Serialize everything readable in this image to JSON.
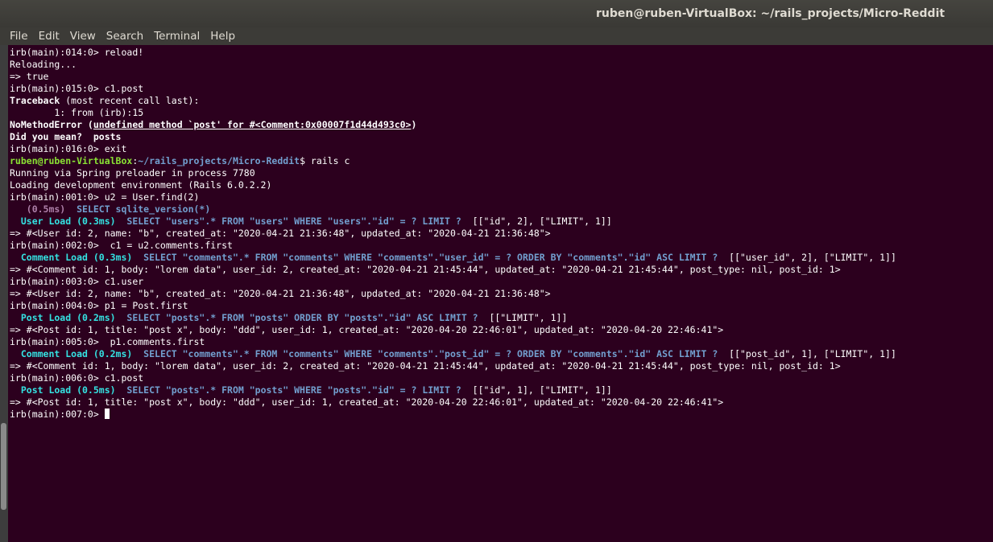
{
  "window": {
    "title": "ruben@ruben-VirtualBox: ~/rails_projects/Micro-Reddit"
  },
  "menu": [
    "File",
    "Edit",
    "View",
    "Search",
    "Terminal",
    "Help"
  ],
  "colors": {
    "background": "#2c001e",
    "prompt_user": "#8ae234",
    "prompt_path": "#729fcf",
    "model_load": "#34e2e2",
    "sql": "#729fcf",
    "timing": "#ad7fa8"
  },
  "terminal": {
    "lines": [
      [
        {
          "t": "irb(main):014:0> reload!",
          "s": "plain"
        }
      ],
      [
        {
          "t": "Reloading...",
          "s": "plain"
        }
      ],
      [
        {
          "t": "=> true",
          "s": "plain"
        }
      ],
      [
        {
          "t": "irb(main):015:0> c1.post",
          "s": "plain"
        }
      ],
      [
        {
          "t": "Traceback",
          "s": "bold"
        },
        {
          "t": " (most recent call last):",
          "s": "plain"
        }
      ],
      [
        {
          "t": "        1: from (irb):15",
          "s": "plain"
        }
      ],
      [
        {
          "t": "NoMethodError (",
          "s": "bold"
        },
        {
          "t": "undefined method `post' for #<Comment:0x00007f1d44d493c0>",
          "s": "boldul"
        },
        {
          "t": ")",
          "s": "bold"
        }
      ],
      [
        {
          "t": "Did you mean?  posts",
          "s": "bold"
        }
      ],
      [
        {
          "t": "irb(main):016:0> exit",
          "s": "plain"
        }
      ],
      [
        {
          "t": "ruben@ruben-VirtualBox",
          "s": "green"
        },
        {
          "t": ":",
          "s": "plain"
        },
        {
          "t": "~/rails_projects/Micro-Reddit",
          "s": "blue"
        },
        {
          "t": "$ rails c",
          "s": "plain"
        }
      ],
      [
        {
          "t": "Running via Spring preloader in process 7780",
          "s": "plain"
        }
      ],
      [
        {
          "t": "Loading development environment (Rails 6.0.2.2)",
          "s": "plain"
        }
      ],
      [
        {
          "t": "irb(main):001:0> u2 = User.find(2)",
          "s": "plain"
        }
      ],
      [
        {
          "t": "   (0.5ms)  ",
          "s": "magenta"
        },
        {
          "t": "SELECT sqlite_version(*)",
          "s": "sqlblue"
        }
      ],
      [
        {
          "t": "  User Load (0.3ms)  ",
          "s": "cyan"
        },
        {
          "t": "SELECT \"users\".* FROM \"users\" WHERE \"users\".\"id\" = ? LIMIT ?",
          "s": "sqlblue"
        },
        {
          "t": "  [[\"id\", 2], [\"LIMIT\", 1]]",
          "s": "plain"
        }
      ],
      [
        {
          "t": "=> #<User id: 2, name: \"b\", created_at: \"2020-04-21 21:36:48\", updated_at: \"2020-04-21 21:36:48\">",
          "s": "plain"
        }
      ],
      [
        {
          "t": "irb(main):002:0>  c1 = u2.comments.first",
          "s": "plain"
        }
      ],
      [
        {
          "t": "  Comment Load (0.3ms)  ",
          "s": "cyan"
        },
        {
          "t": "SELECT \"comments\".* FROM \"comments\" WHERE \"comments\".\"user_id\" = ? ORDER BY \"comments\".\"id\" ASC LIMIT ?",
          "s": "sqlblue"
        },
        {
          "t": "  [[\"user_id\", 2], [\"LIMIT\", 1]]",
          "s": "plain"
        }
      ],
      [
        {
          "t": "=> #<Comment id: 1, body: \"lorem data\", user_id: 2, created_at: \"2020-04-21 21:45:44\", updated_at: \"2020-04-21 21:45:44\", post_type: nil, post_id: 1>",
          "s": "plain"
        }
      ],
      [
        {
          "t": "irb(main):003:0> c1.user",
          "s": "plain"
        }
      ],
      [
        {
          "t": "=> #<User id: 2, name: \"b\", created_at: \"2020-04-21 21:36:48\", updated_at: \"2020-04-21 21:36:48\">",
          "s": "plain"
        }
      ],
      [
        {
          "t": "irb(main):004:0> p1 = Post.first",
          "s": "plain"
        }
      ],
      [
        {
          "t": "  Post Load (0.2ms)  ",
          "s": "cyan"
        },
        {
          "t": "SELECT \"posts\".* FROM \"posts\" ORDER BY \"posts\".\"id\" ASC LIMIT ?",
          "s": "sqlblue"
        },
        {
          "t": "  [[\"LIMIT\", 1]]",
          "s": "plain"
        }
      ],
      [
        {
          "t": "=> #<Post id: 1, title: \"post x\", body: \"ddd\", user_id: 1, created_at: \"2020-04-20 22:46:01\", updated_at: \"2020-04-20 22:46:41\">",
          "s": "plain"
        }
      ],
      [
        {
          "t": "irb(main):005:0>  p1.comments.first",
          "s": "plain"
        }
      ],
      [
        {
          "t": "  Comment Load (0.2ms)  ",
          "s": "cyan"
        },
        {
          "t": "SELECT \"comments\".* FROM \"comments\" WHERE \"comments\".\"post_id\" = ? ORDER BY \"comments\".\"id\" ASC LIMIT ?",
          "s": "sqlblue"
        },
        {
          "t": "  [[\"post_id\", 1], [\"LIMIT\", 1]]",
          "s": "plain"
        }
      ],
      [
        {
          "t": "=> #<Comment id: 1, body: \"lorem data\", user_id: 2, created_at: \"2020-04-21 21:45:44\", updated_at: \"2020-04-21 21:45:44\", post_type: nil, post_id: 1>",
          "s": "plain"
        }
      ],
      [
        {
          "t": "irb(main):006:0> c1.post",
          "s": "plain"
        }
      ],
      [
        {
          "t": "  Post Load (0.5ms)  ",
          "s": "cyan"
        },
        {
          "t": "SELECT \"posts\".* FROM \"posts\" WHERE \"posts\".\"id\" = ? LIMIT ?",
          "s": "sqlblue"
        },
        {
          "t": "  [[\"id\", 1], [\"LIMIT\", 1]]",
          "s": "plain"
        }
      ],
      [
        {
          "t": "=> #<Post id: 1, title: \"post x\", body: \"ddd\", user_id: 1, created_at: \"2020-04-20 22:46:01\", updated_at: \"2020-04-20 22:46:41\">",
          "s": "plain"
        }
      ],
      [
        {
          "t": "irb(main):007:0> ",
          "s": "plain"
        }
      ]
    ]
  }
}
